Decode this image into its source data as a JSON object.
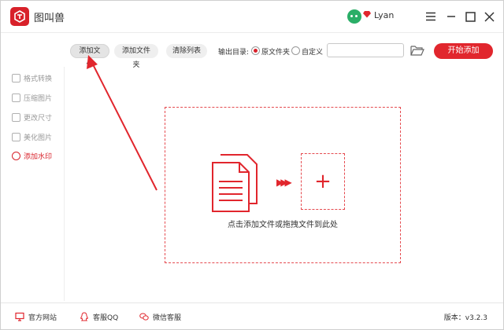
{
  "app": {
    "title": "图叫兽"
  },
  "user": {
    "name": "Lyan"
  },
  "toolbar": {
    "add_file": "添加文件",
    "add_folder": "添加文件夹",
    "clear_list": "清除列表",
    "output_label": "输出目录:",
    "option_original": "原文件夹",
    "option_custom": "自定义",
    "path_value": "",
    "start": "开始添加"
  },
  "sidebar": {
    "items": [
      {
        "label": "格式转换",
        "icon": "convert-icon"
      },
      {
        "label": "压缩图片",
        "icon": "compress-icon"
      },
      {
        "label": "更改尺寸",
        "icon": "resize-icon"
      },
      {
        "label": "美化图片",
        "icon": "beautify-icon"
      },
      {
        "label": "添加水印",
        "icon": "watermark-icon",
        "active": true
      }
    ]
  },
  "main": {
    "drop_hint": "点击添加文件或拖拽文件到此处"
  },
  "footer": {
    "website": "官方网站",
    "qq": "客服QQ",
    "wechat": "微信客服",
    "version": "版本：v3.2.3"
  },
  "colors": {
    "accent": "#e1262d",
    "logo": "#d8212a",
    "wechat": "#2aae67"
  }
}
